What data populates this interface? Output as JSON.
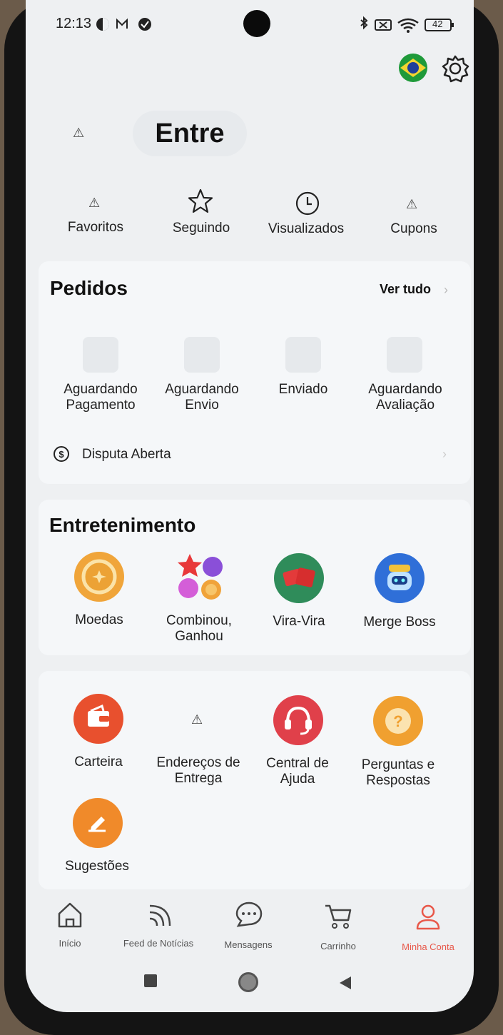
{
  "status_bar": {
    "time": "12:13",
    "battery": "42"
  },
  "header": {
    "flag_icon": "brazil-flag-icon",
    "settings_icon": "gear-icon"
  },
  "login": {
    "label": "Entre"
  },
  "quick_links": [
    {
      "label": "Favoritos",
      "icon": "warning-icon"
    },
    {
      "label": "Seguindo",
      "icon": "star-icon"
    },
    {
      "label": "Visualizados",
      "icon": "clock-icon"
    },
    {
      "label": "Cupons",
      "icon": "warning-icon"
    }
  ],
  "orders": {
    "title": "Pedidos",
    "view_all": "Ver tudo",
    "statuses": [
      {
        "label": "Aguardando\nPagamento"
      },
      {
        "label": "Aguardando\nEnvio"
      },
      {
        "label": "Enviado"
      },
      {
        "label": "Aguardando\nAvaliação"
      }
    ],
    "dispute": "Disputa Aberta"
  },
  "entertainment": {
    "title": "Entretenimento",
    "items": [
      {
        "label": "Moedas",
        "color": "#f0a53a"
      },
      {
        "label": "Combinou,\nGanhou",
        "color": "#e84a6a"
      },
      {
        "label": "Vira-Vira",
        "color": "#2f8c5a"
      },
      {
        "label": "Merge Boss",
        "color": "#2f6fd8"
      }
    ]
  },
  "services": {
    "items": [
      {
        "label": "Carteira",
        "color": "#e8502e"
      },
      {
        "label": "Endereços de\nEntrega",
        "icon": "warning-icon"
      },
      {
        "label": "Central de\nAjuda",
        "color": "#e0404a"
      },
      {
        "label": "Perguntas e\nRespostas",
        "color": "#f0a030"
      },
      {
        "label": "Sugestões",
        "color": "#f08a2a"
      }
    ]
  },
  "bottom_nav": {
    "items": [
      {
        "label": "Início"
      },
      {
        "label": "Feed de Notícias"
      },
      {
        "label": "Mensagens"
      },
      {
        "label": "Carrinho"
      },
      {
        "label": "Minha Conta",
        "active": true
      }
    ],
    "active_color": "#e8584a"
  }
}
